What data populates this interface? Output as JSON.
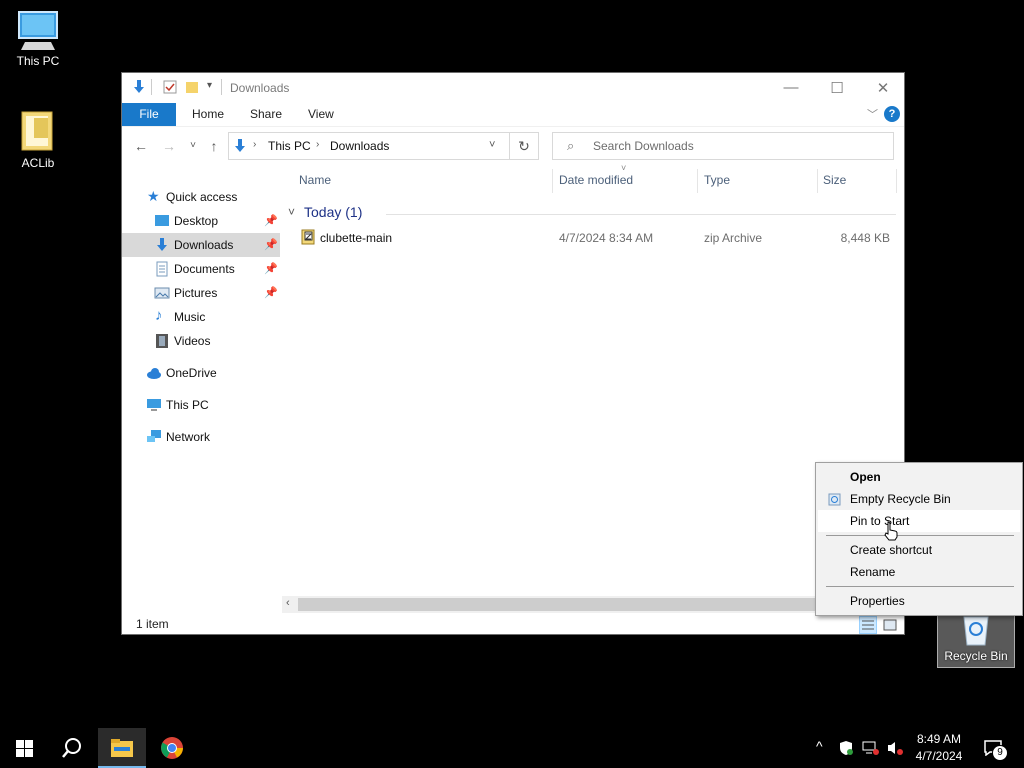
{
  "desktop": {
    "icons": [
      {
        "label": "This PC"
      },
      {
        "label": "ACLib"
      },
      {
        "label": "Recycle Bin"
      }
    ]
  },
  "window": {
    "title": "Downloads",
    "ribbon_tabs": [
      "File",
      "Home",
      "Share",
      "View"
    ],
    "address": {
      "crumbs": [
        "This PC",
        "Downloads"
      ]
    },
    "search_placeholder": "Search Downloads",
    "nav": [
      {
        "label": "Quick access"
      },
      {
        "label": "Desktop",
        "pinned": true
      },
      {
        "label": "Downloads",
        "pinned": true,
        "selected": true
      },
      {
        "label": "Documents",
        "pinned": true
      },
      {
        "label": "Pictures",
        "pinned": true
      },
      {
        "label": "Music"
      },
      {
        "label": "Videos"
      },
      {
        "label": "OneDrive"
      },
      {
        "label": "This PC"
      },
      {
        "label": "Network"
      }
    ],
    "columns": [
      "Name",
      "Date modified",
      "Type",
      "Size"
    ],
    "group": "Today (1)",
    "files": [
      {
        "name": "clubette-main",
        "date": "4/7/2024 8:34 AM",
        "type": "zip Archive",
        "size": "8,448 KB"
      }
    ],
    "status": "1 item"
  },
  "context_menu": {
    "items": [
      "Open",
      "Empty Recycle Bin",
      "Pin to Start",
      "Create shortcut",
      "Rename",
      "Properties"
    ]
  },
  "taskbar": {
    "time": "8:49 AM",
    "date": "4/7/2024",
    "notification_count": "9"
  },
  "colors": {
    "accent": "#1979ca",
    "selection": "#d9d9d9"
  }
}
